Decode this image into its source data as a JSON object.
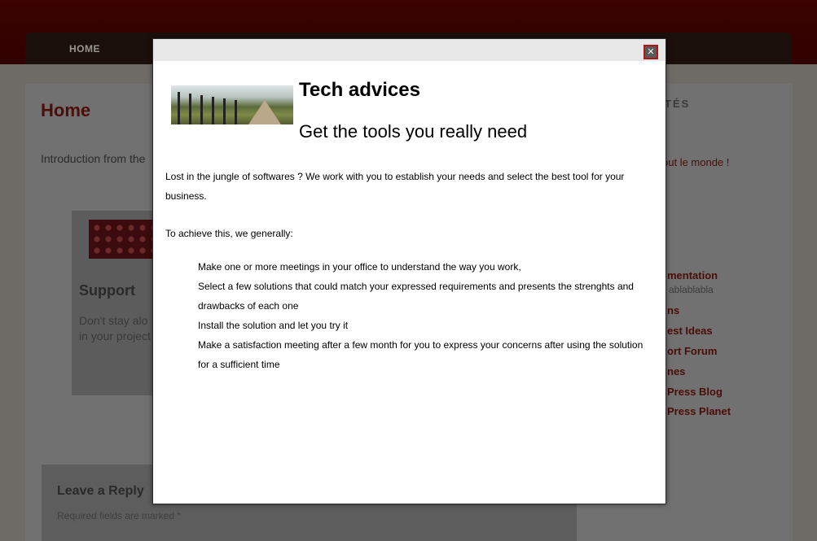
{
  "nav": {
    "home_label": "HOME"
  },
  "page": {
    "title": "Home",
    "intro": "Introduction from the"
  },
  "support": {
    "title": "Support",
    "text_line1": "Don't stay alo",
    "text_line2": "in your project"
  },
  "reply": {
    "title": "Leave a Reply",
    "note": "Required fields are marked *"
  },
  "sidebar": {
    "heading": "TÉS",
    "recent_post": "out le monde !",
    "links": [
      {
        "label": "mentation",
        "desc": "ablablabla"
      },
      {
        "label": "ns"
      },
      {
        "label": "est Ideas"
      },
      {
        "label": "ort Forum"
      },
      {
        "label": "nes"
      },
      {
        "label": "Press Blog"
      },
      {
        "label": "Press Planet"
      }
    ]
  },
  "modal": {
    "close_label": "✕",
    "title": "Tech advices",
    "subtitle": "Get the tools you really need",
    "paragraph": "Lost in the jungle of softwares ? We work with you to establish your needs and select the best tool for your business.",
    "lead": "To achieve this, we generally:",
    "steps": [
      "Make one or more meetings in your office to understand the way you work,",
      "Select a few solutions that could match your expressed requirements and presents the strenghts and drawbacks of each one",
      "Install the solution and let you try it",
      "Make a satisfaction meeting after a few month for you to express your concerns after using the solution for a sufficient time"
    ]
  }
}
